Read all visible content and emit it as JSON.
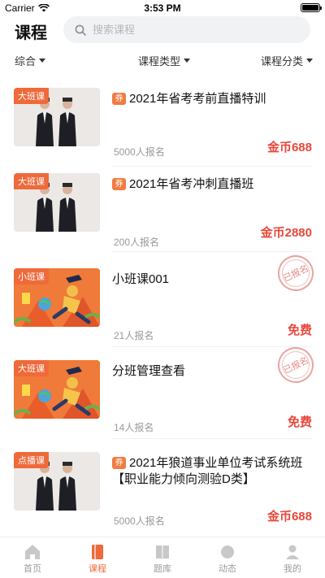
{
  "status_bar": {
    "carrier": "Carrier",
    "time": "3:53 PM"
  },
  "header": {
    "title": "课程"
  },
  "search": {
    "placeholder": "搜索课程"
  },
  "filters": [
    {
      "label": "综合"
    },
    {
      "label": "课程类型"
    },
    {
      "label": "课程分类"
    }
  ],
  "courses": [
    {
      "tag": "大班课",
      "coupon": "券",
      "title": "2021年省考考前直播特训",
      "enrolled": "5000人报名",
      "price": "金币688"
    },
    {
      "tag": "大班课",
      "coupon": "券",
      "title": "2021年省考冲刺直播班",
      "enrolled": "200人报名",
      "price": "金币2880"
    },
    {
      "tag": "小班课",
      "title": "小班课001",
      "enrolled": "21人报名",
      "price": "免费",
      "stamp": "已报名"
    },
    {
      "tag": "大班课",
      "title": "分班管理查看",
      "enrolled": "14人报名",
      "price": "免费",
      "stamp": "已报名"
    },
    {
      "tag": "点播课",
      "coupon": "券",
      "title": "2021年狼道事业单位考试系统班【职业能力倾向测验D类】",
      "enrolled": "5000人报名",
      "price": "金币688"
    }
  ],
  "tabbar": [
    {
      "label": "首页",
      "icon": "home-icon"
    },
    {
      "label": "课程",
      "icon": "book-icon",
      "active": true
    },
    {
      "label": "题库",
      "icon": "question-bank-icon"
    },
    {
      "label": "动态",
      "icon": "news-icon"
    },
    {
      "label": "我的",
      "icon": "profile-icon"
    }
  ],
  "colors": {
    "accent": "#ef6a3b",
    "price": "#e8473b"
  }
}
